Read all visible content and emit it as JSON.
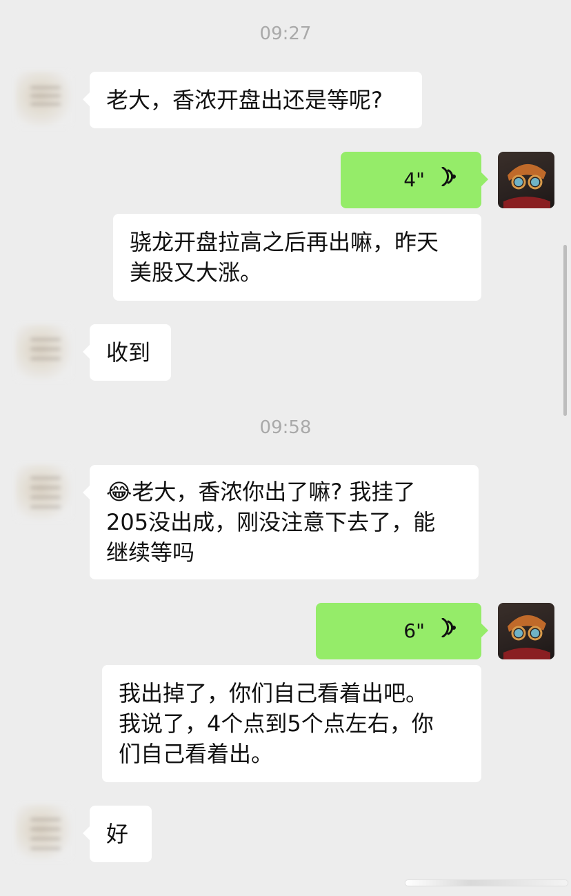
{
  "chat": {
    "timestamps": [
      "09:27",
      "09:58"
    ],
    "messages": [
      {
        "side": "left",
        "type": "text",
        "text": "老大，香浓开盘出还是等呢?"
      },
      {
        "side": "right",
        "type": "voice",
        "duration": "4\""
      },
      {
        "side": "right",
        "type": "text",
        "lines": [
          "骁龙开盘拉高之后再出嘛，昨天",
          "美股又大涨。"
        ]
      },
      {
        "side": "left",
        "type": "text",
        "text": "收到"
      },
      {
        "side": "left",
        "type": "text",
        "emoji": "😂",
        "lines": [
          "老大，香浓你出了嘛? 我挂了",
          "205没出成，刚没注意下去了，能",
          "继续等吗"
        ]
      },
      {
        "side": "right",
        "type": "voice",
        "duration": "6\""
      },
      {
        "side": "right",
        "type": "text",
        "lines": [
          "我出掉了，你们自己看着出吧。",
          "我说了，4个点到5个点左右，你",
          "们自己看着出。"
        ]
      },
      {
        "side": "left",
        "type": "text",
        "text": "好"
      }
    ]
  },
  "icons": {
    "voice": "voice-wave-icon",
    "avatar_left": "contact-avatar-blurred",
    "avatar_right": "cat-avatar"
  },
  "colors": {
    "background": "#ededed",
    "outgoing_bubble": "#95ec69",
    "incoming_bubble": "#ffffff",
    "timestamp_text": "#a9a9a9"
  }
}
